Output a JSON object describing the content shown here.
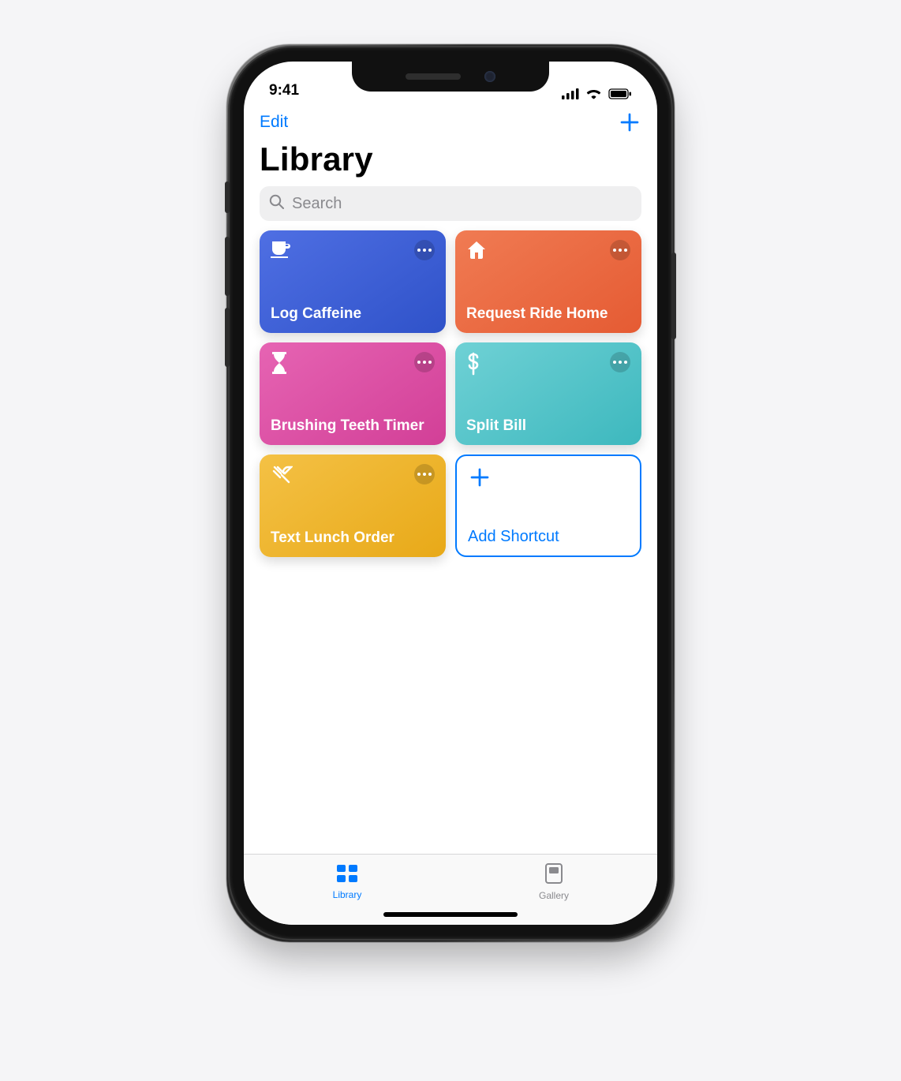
{
  "status": {
    "time": "9:41"
  },
  "nav": {
    "edit": "Edit"
  },
  "title": "Library",
  "search": {
    "placeholder": "Search"
  },
  "cards": {
    "0": {
      "label": "Log Caffeine",
      "icon": "cup-icon",
      "gradient": "g-blue"
    },
    "1": {
      "label": "Request Ride Home",
      "icon": "home-icon",
      "gradient": "g-orange"
    },
    "2": {
      "label": "Brushing Teeth Timer",
      "icon": "hourglass-icon",
      "gradient": "g-pink"
    },
    "3": {
      "label": "Split Bill",
      "icon": "dollar-icon",
      "gradient": "g-teal"
    },
    "4": {
      "label": "Text Lunch Order",
      "icon": "utensils-icon",
      "gradient": "g-yellow"
    }
  },
  "add_card": {
    "label": "Add Shortcut"
  },
  "tabs": {
    "library": "Library",
    "gallery": "Gallery"
  },
  "colors": {
    "accent": "#007aff"
  }
}
